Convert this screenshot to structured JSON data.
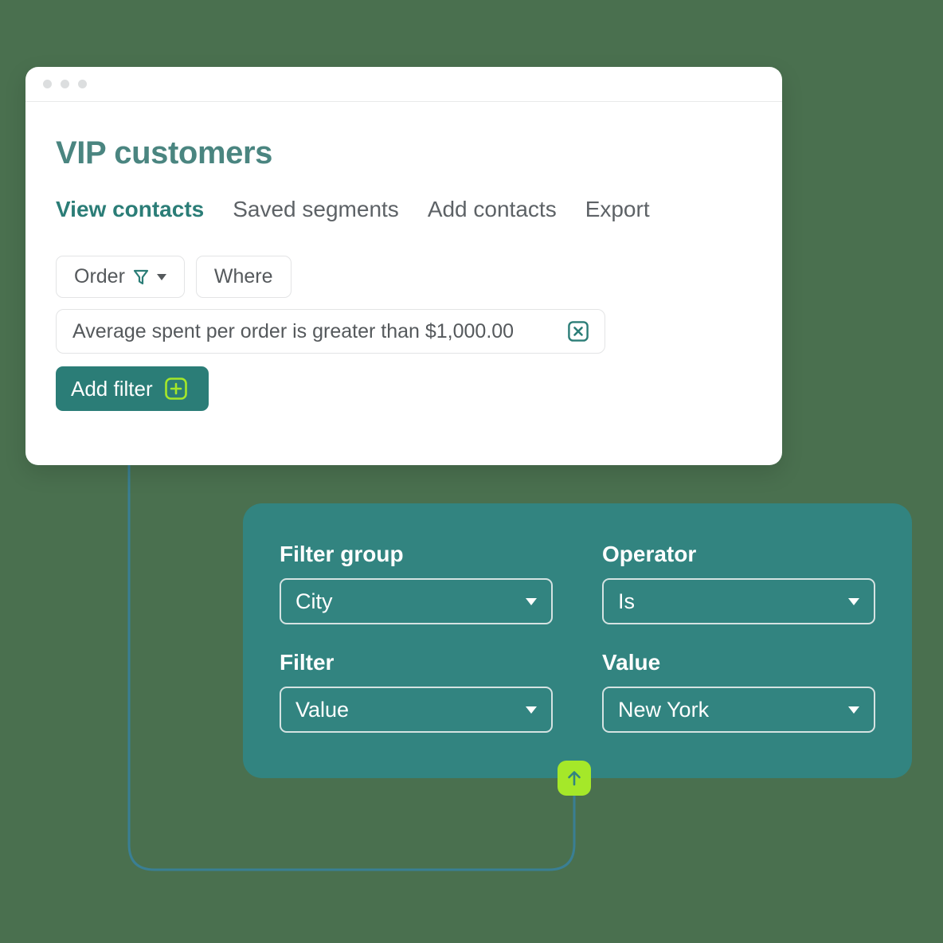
{
  "window": {
    "dots": [
      "dot-red",
      "dot-yellow",
      "dot-green"
    ]
  },
  "header": {
    "title": "VIP customers"
  },
  "tabs": [
    {
      "label": "View contacts",
      "active": true
    },
    {
      "label": "Saved segments",
      "active": false
    },
    {
      "label": "Add contacts",
      "active": false
    },
    {
      "label": "Export",
      "active": false
    }
  ],
  "controls": {
    "order_label": "Order",
    "order_icon": "funnel-icon",
    "order_caret": "chevron-down-icon",
    "where_label": "Where"
  },
  "filter_chip": {
    "text": "Average spent per order is greater than $1,000.00",
    "remove_icon": "close-box-icon"
  },
  "add_filter": {
    "label": "Add filter",
    "icon": "plus-box-icon"
  },
  "panel": {
    "fields": [
      {
        "label": "Filter group",
        "value": "City",
        "caret": "chevron-down-icon"
      },
      {
        "label": "Operator",
        "value": "Is",
        "caret": "chevron-down-icon"
      },
      {
        "label": "Filter",
        "value": "Value",
        "caret": "chevron-down-icon"
      },
      {
        "label": "Value",
        "value": "New York",
        "caret": "chevron-down-icon"
      }
    ],
    "submit_icon": "arrow-up-icon"
  },
  "colors": {
    "background": "#4a704f",
    "panel_teal": "#328480",
    "accent_teal": "#2b7d77",
    "title_teal": "#4a8580",
    "lime": "#a5e829",
    "connector": "#3a7f94"
  }
}
